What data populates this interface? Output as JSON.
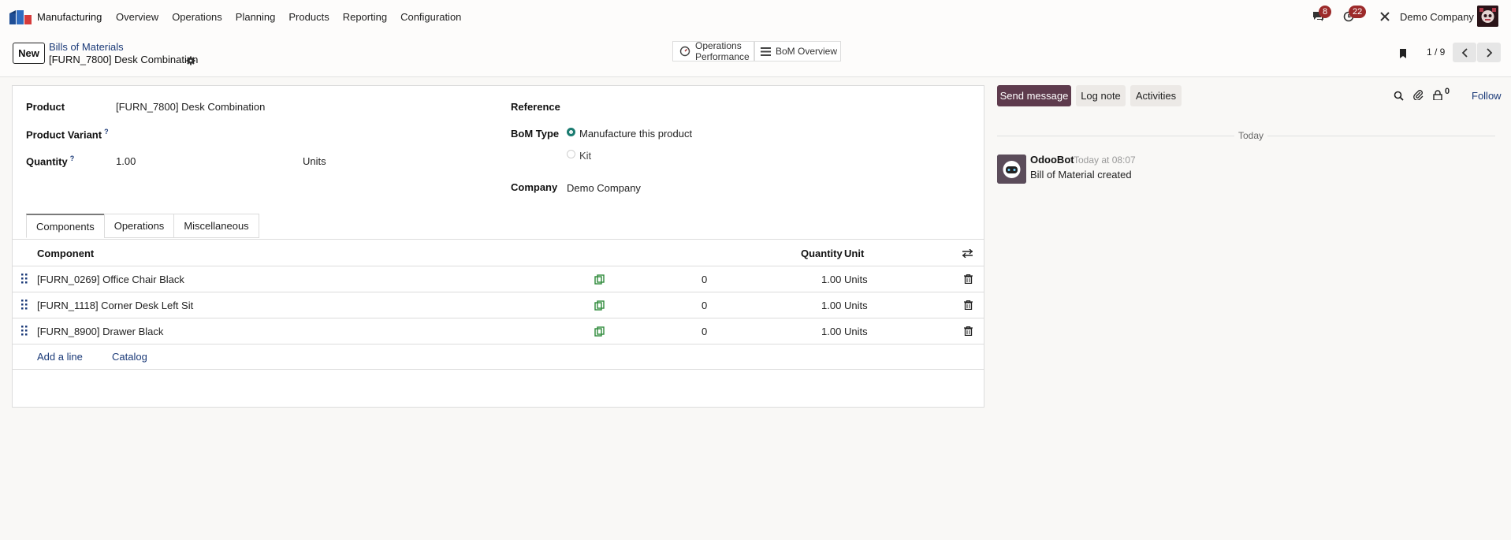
{
  "nav": {
    "app_name": "Manufacturing",
    "menu": [
      "Overview",
      "Operations",
      "Planning",
      "Products",
      "Reporting",
      "Configuration"
    ],
    "messages_count": "8",
    "activities_count": "22",
    "company": "Demo Company"
  },
  "control": {
    "new_label": "New",
    "breadcrumb_parent": "Bills of Materials",
    "record_title": "[FURN_7800] Desk Combination",
    "smart_ops_line1": "Operations",
    "smart_ops_line2": "Performance",
    "smart_bom": "BoM Overview",
    "pager": "1 / 9"
  },
  "form": {
    "product_label": "Product",
    "product_value": "[FURN_7800] Desk Combination",
    "variant_label": "Product Variant",
    "quantity_label": "Quantity",
    "quantity_value": "1.00",
    "quantity_uom": "Units",
    "reference_label": "Reference",
    "bom_type_label": "BoM Type",
    "bom_type_option1": "Manufacture this product",
    "bom_type_option2": "Kit",
    "company_label": "Company",
    "company_value": "Demo Company",
    "help_mark": "?"
  },
  "tabs": [
    "Components",
    "Operations",
    "Miscellaneous"
  ],
  "table": {
    "headers": {
      "component": "Component",
      "quantity": "Quantity",
      "unit": "Unit"
    },
    "rows": [
      {
        "component": "[FURN_0269] Office Chair Black",
        "avail": "0",
        "qty": "1.00",
        "unit": "Units"
      },
      {
        "component": "[FURN_1118] Corner Desk Left Sit",
        "avail": "0",
        "qty": "1.00",
        "unit": "Units"
      },
      {
        "component": "[FURN_8900] Drawer Black",
        "avail": "0",
        "qty": "1.00",
        "unit": "Units"
      }
    ],
    "add_line": "Add a line",
    "catalog": "Catalog"
  },
  "chatter": {
    "send_message": "Send message",
    "log_note": "Log note",
    "activities": "Activities",
    "followers_count": "0",
    "follow": "Follow",
    "today": "Today",
    "author": "OdooBot",
    "date": "Today at 08:07",
    "body": "Bill of Material created"
  },
  "colors": {
    "primary": "#5e3b4d",
    "link": "#1b3a78",
    "badge": "#9c2a2a",
    "radio_active": "#1a7b70"
  }
}
